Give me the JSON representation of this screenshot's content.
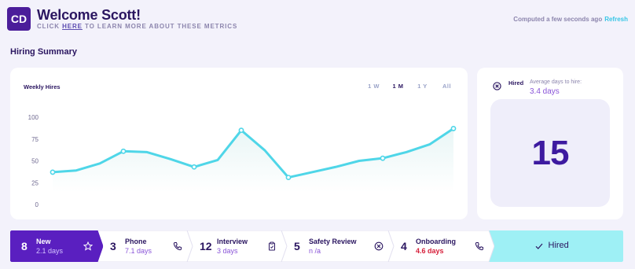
{
  "header": {
    "avatar_initials": "CD",
    "welcome": "Welcome Scott!",
    "learn_prefix": "CLICK",
    "learn_link": "HERE",
    "learn_suffix": "TO LEARN MORE ABOUT THESE METRICS",
    "computed": "Computed a few seconds ago",
    "refresh_label": "Refresh"
  },
  "section_title": "Hiring Summary",
  "chart_data": {
    "type": "line",
    "title": "Weekly Hires",
    "range_options": [
      "1 W",
      "1 M",
      "1 Y",
      "All"
    ],
    "active_range": "1 M",
    "y_ticks": [
      100,
      75,
      50,
      25,
      0
    ],
    "ylim": [
      0,
      100
    ],
    "x": [
      1,
      2,
      3,
      4,
      5,
      6,
      7,
      8,
      9,
      10,
      11,
      12,
      13,
      14,
      15,
      16,
      17,
      18,
      19,
      20
    ],
    "series": [
      {
        "values": [
          37,
          39,
          47,
          61,
          60,
          52,
          43,
          51,
          85,
          62,
          31,
          37,
          43,
          50,
          53,
          60,
          69,
          87
        ],
        "marked_points": [
          0,
          3,
          6,
          8,
          10,
          14,
          17
        ],
        "color": "#4fd6e8"
      }
    ]
  },
  "hired_card": {
    "label": "Hired",
    "avg_label": "Average days to hire:",
    "avg_value": "3.4 days",
    "count": "15"
  },
  "pipeline": [
    {
      "count": "8",
      "name": "New",
      "days": "2.1 days",
      "icon": "star-icon"
    },
    {
      "count": "3",
      "name": "Phone",
      "days": "7.1 days",
      "icon": "phone-icon"
    },
    {
      "count": "12",
      "name": "Interview",
      "days": "3 days",
      "icon": "clipboard-icon"
    },
    {
      "count": "5",
      "name": "Safety Review",
      "days": "n /a",
      "icon": "x-circle-icon"
    },
    {
      "count": "4",
      "name": "Onboarding",
      "days": "4.6 days",
      "icon": "phone-icon"
    }
  ],
  "hired_stage": {
    "label": "Hired",
    "icon": "check-icon"
  },
  "colors": {
    "accent": "#5a1fc0",
    "line": "#4fd6e8",
    "hired_stage_bg": "#9ef0f5",
    "danger": "#d61f3a"
  }
}
